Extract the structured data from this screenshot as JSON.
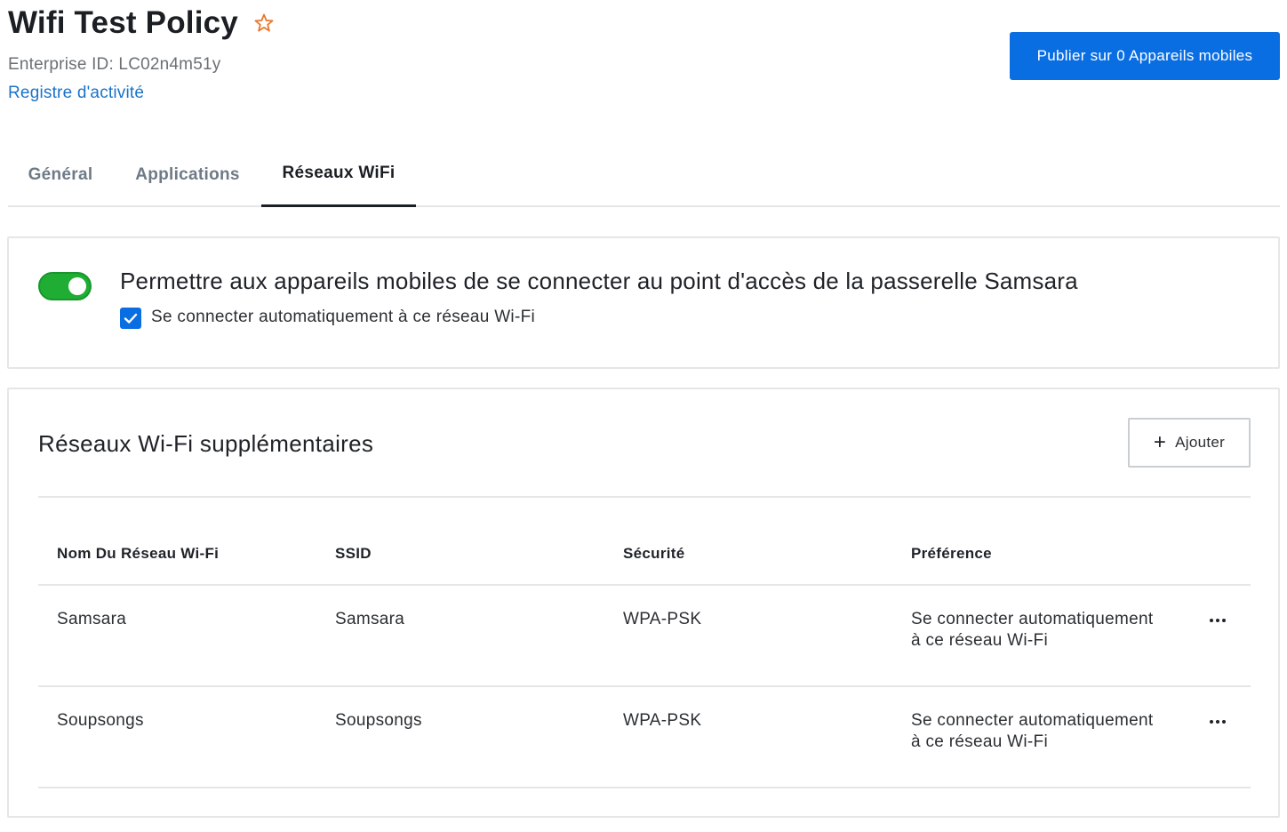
{
  "header": {
    "title": "Wifi Test Policy",
    "enterprise_id": "Enterprise ID: LC02n4m51y",
    "activity_link": "Registre d'activité",
    "publish_button": "Publier sur 0 Appareils mobiles",
    "star_color": "#e8772e"
  },
  "tabs": [
    {
      "label": "Général",
      "active": false
    },
    {
      "label": "Applications",
      "active": false
    },
    {
      "label": "Réseaux WiFi",
      "active": true
    }
  ],
  "hotspot": {
    "toggle_on": true,
    "label": "Permettre aux appareils mobiles de se connecter au point d'accès de la passerelle Samsara",
    "auto_connect_checked": true,
    "auto_connect_label": "Se connecter automatiquement à ce réseau Wi-Fi"
  },
  "networks": {
    "title": "Réseaux Wi-Fi supplémentaires",
    "add_button": "Ajouter",
    "columns": [
      "Nom Du Réseau Wi-Fi",
      "SSID",
      "Sécurité",
      "Préférence"
    ],
    "rows": [
      {
        "name": "Samsara",
        "ssid": "Samsara",
        "security": "WPA-PSK",
        "pref_line1": "Se connecter automatiquement",
        "pref_line2": "à ce réseau Wi-Fi"
      },
      {
        "name": "Soupsongs",
        "ssid": "Soupsongs",
        "security": "WPA-PSK",
        "pref_line1": "Se connecter automatiquement",
        "pref_line2": "à ce réseau Wi-Fi"
      }
    ]
  },
  "colors": {
    "primary": "#0a6ee3",
    "toggle_on": "#1fad34",
    "link": "#1a73c8"
  }
}
